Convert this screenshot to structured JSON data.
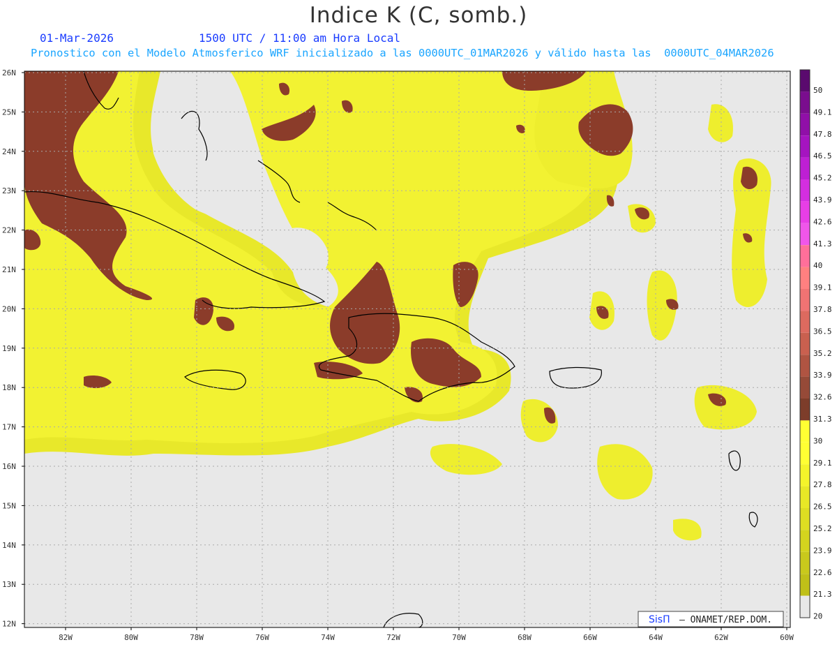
{
  "header": {
    "title": "Indice K (C, somb.)",
    "date": "01-Mar-2026",
    "time": "1500 UTC / 11:00 am Hora Local",
    "description": "Pronostico con el Modelo Atmosferico WRF inicializado a las 0000UTC_01MAR2026 y válido hasta las  0000UTC_04MAR2026"
  },
  "axes": {
    "lat_labels": [
      "26N",
      "25N",
      "24N",
      "23N",
      "22N",
      "21N",
      "20N",
      "19N",
      "18N",
      "17N",
      "16N",
      "15N",
      "14N",
      "13N",
      "12N"
    ],
    "lon_labels": [
      "82W",
      "80W",
      "78W",
      "76W",
      "74W",
      "72W",
      "70W",
      "68W",
      "66W",
      "64W",
      "62W",
      "60W"
    ]
  },
  "colorbar": {
    "labels": [
      "50",
      "49.1",
      "47.8",
      "46.5",
      "45.2",
      "43.9",
      "42.6",
      "41.3",
      "40",
      "39.1",
      "37.8",
      "36.5",
      "35.2",
      "33.9",
      "32.6",
      "31.3",
      "30",
      "29.1",
      "27.8",
      "26.5",
      "25.2",
      "23.9",
      "22.6",
      "21.3",
      "20"
    ],
    "colors": [
      "#5a0a6e",
      "#7a0d8e",
      "#900fa8",
      "#a514c0",
      "#be1fd4",
      "#d42ee0",
      "#e83ee6",
      "#f056ea",
      "#ff6f9a",
      "#ff8080",
      "#f07373",
      "#dd6a5f",
      "#c9604f",
      "#b05442",
      "#964a38",
      "#7d3d2a",
      "#ffff33",
      "#ffff33",
      "#f4f42a",
      "#e8e826",
      "#dede22",
      "#d4d41e",
      "#c9c91c",
      "#c0c018",
      "#e8e8e8"
    ]
  },
  "credit": {
    "brand": "SisΠ",
    "text": "– ONAMET/REP.DOM."
  },
  "colors": {
    "background": "#e8e8e8",
    "low_k": "#d8d81c",
    "mid_k": "#f0f032",
    "high_k": "#8b3c2a",
    "coastline": "#000000"
  }
}
